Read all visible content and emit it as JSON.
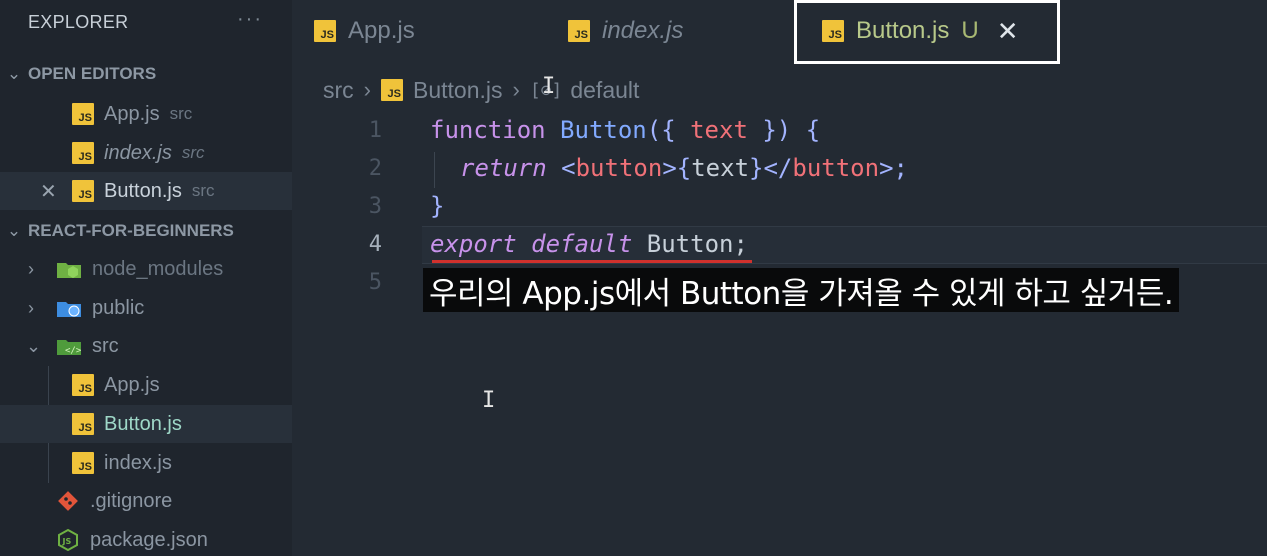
{
  "explorer": {
    "title": "EXPLORER",
    "more": "···",
    "open_editors": {
      "title": "OPEN EDITORS",
      "items": [
        {
          "name": "App.js",
          "desc": "src",
          "italic": false,
          "active": false
        },
        {
          "name": "index.js",
          "desc": "src",
          "italic": true,
          "active": false
        },
        {
          "name": "Button.js",
          "desc": "src",
          "italic": false,
          "active": true,
          "close": "✕"
        }
      ]
    },
    "project": {
      "title": "REACT-FOR-BEGINNERS",
      "items": [
        {
          "name": "node_modules",
          "type": "folder"
        },
        {
          "name": "public",
          "type": "folder"
        },
        {
          "name": "src",
          "type": "folder-open"
        },
        {
          "name": "App.js",
          "type": "js"
        },
        {
          "name": "Button.js",
          "type": "js"
        },
        {
          "name": "index.js",
          "type": "js"
        },
        {
          "name": ".gitignore",
          "type": "git"
        },
        {
          "name": "package.json",
          "type": "node"
        }
      ]
    }
  },
  "tabs": [
    {
      "label": "App.js",
      "icon": "JS"
    },
    {
      "label": "index.js",
      "icon": "JS"
    },
    {
      "label": "Button.js",
      "icon": "JS",
      "badge": "U",
      "close": "✕"
    }
  ],
  "breadcrumbs": {
    "folder": "src",
    "file": "Button.js",
    "symbol_icon": "[⊘]",
    "symbol": "default"
  },
  "editor": {
    "line_numbers": [
      "1",
      "2",
      "3",
      "4",
      "5"
    ],
    "lines": {
      "l1": {
        "kw": "function",
        "fn": "Button",
        "open": "({",
        "param": "text",
        "close": "})",
        "brace": "{"
      },
      "l2": {
        "kw": "return",
        "lt": "<",
        "tag": "button",
        "gt": ">",
        "ob": "{",
        "text": "text",
        "cb": "}",
        "close_open": "</",
        "tag2": "button",
        "end": ">;"
      },
      "l3": {
        "brace": "}"
      },
      "l4": {
        "kw1": "export",
        "kw2": "default",
        "ident": "Button",
        "semi": ";"
      }
    }
  },
  "subtitle": "우리의 App.js에서 Button을 가져올 수 있게 하고 싶거든.",
  "colors": {
    "accent_js": "#f0c33a",
    "keyword": "#c792ea",
    "function": "#82aaff",
    "param": "#f07178",
    "error": "#d0312d"
  },
  "icons": {
    "cursor": "I"
  }
}
